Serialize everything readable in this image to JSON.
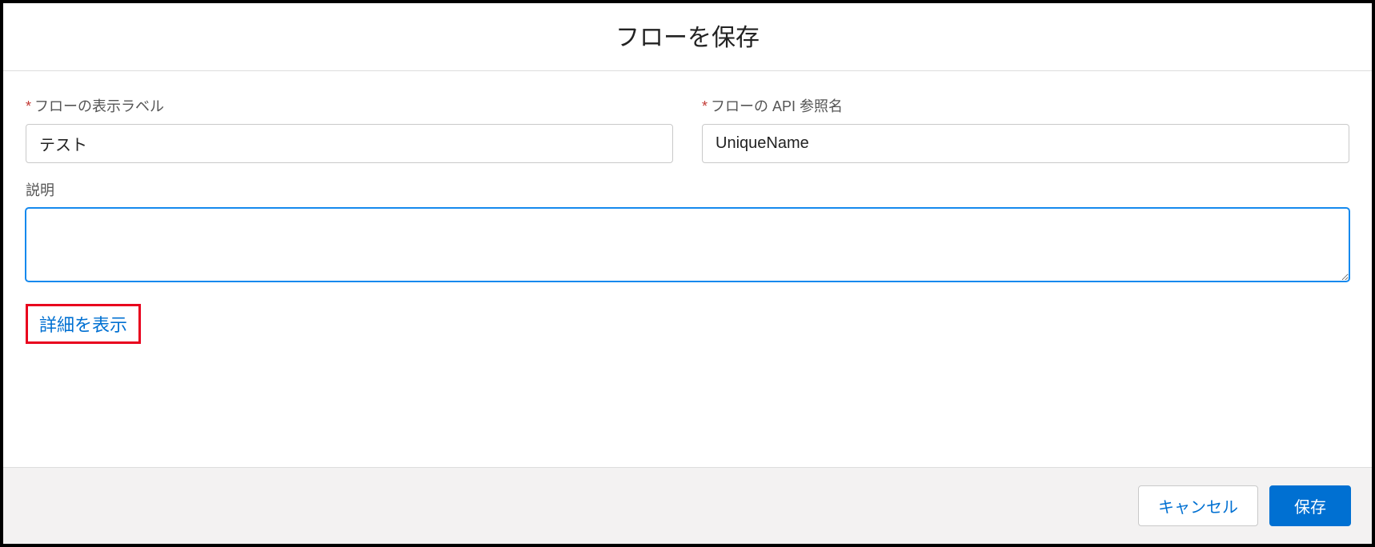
{
  "dialog": {
    "title": "フローを保存"
  },
  "fields": {
    "display_label": {
      "label": "フローの表示ラベル",
      "value": "テスト",
      "required": true
    },
    "api_name": {
      "label": "フローの API 参照名",
      "value": "UniqueName",
      "required": true
    },
    "description": {
      "label": "説明",
      "value": "",
      "required": false
    }
  },
  "links": {
    "show_details": "詳細を表示"
  },
  "buttons": {
    "cancel": "キャンセル",
    "save": "保存"
  }
}
